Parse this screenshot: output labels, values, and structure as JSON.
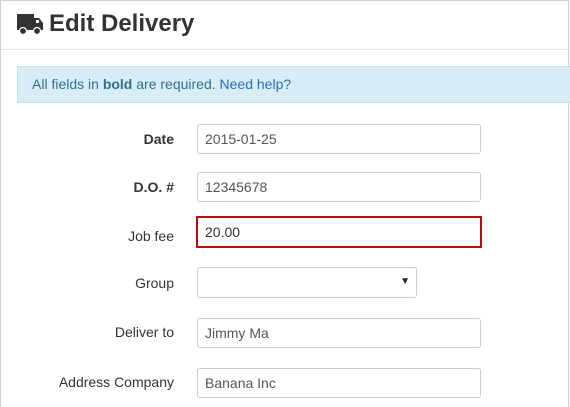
{
  "header": {
    "title": "Edit Delivery",
    "icon": "truck-icon"
  },
  "alert": {
    "prefix": "All fields in ",
    "bold_word": "bold",
    "suffix": " are required. ",
    "help_link": "Need help?"
  },
  "form": {
    "date": {
      "label": "Date",
      "value": "2015-01-25",
      "required": true
    },
    "do_number": {
      "label": "D.O. #",
      "value": "12345678",
      "required": true
    },
    "job_fee": {
      "label": "Job fee",
      "value": "20.00",
      "required": false,
      "focused": true
    },
    "group": {
      "label": "Group",
      "value": "",
      "required": false
    },
    "deliver_to": {
      "label": "Deliver to",
      "value": "Jimmy Ma",
      "required": false
    },
    "address_company": {
      "label": "Address Company",
      "value": "Banana Inc",
      "required": false
    }
  },
  "colors": {
    "alert_bg": "#d9edf7",
    "link": "#2a6eb3",
    "focus_border": "#b90d12"
  }
}
